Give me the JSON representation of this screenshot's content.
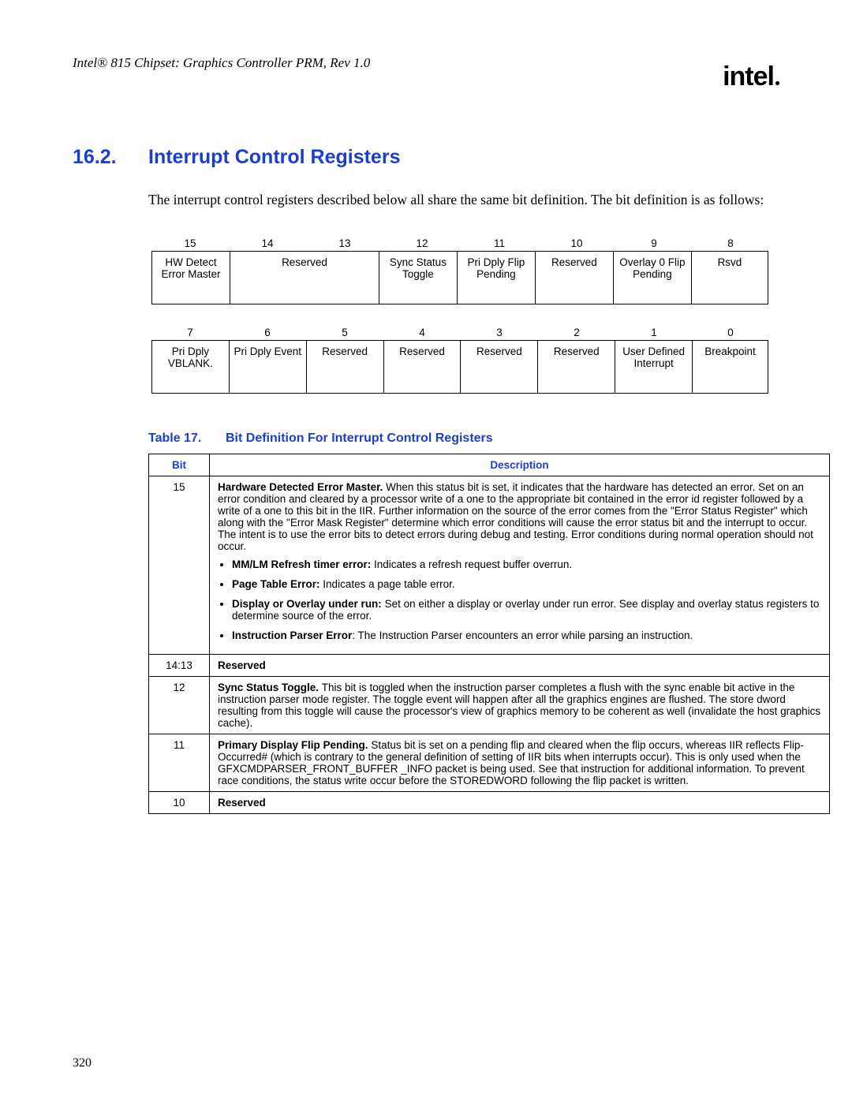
{
  "header": {
    "text": "Intel® 815 Chipset: Graphics Controller PRM, Rev 1.0"
  },
  "logo": "intel",
  "section": {
    "number": "16.2.",
    "title": "Interrupt Control Registers"
  },
  "intro": "The interrupt control registers described below all share the same bit definition. The bit definition is as follows:",
  "bits_high": {
    "headers": [
      "15",
      "14",
      "13",
      "12",
      "11",
      "10",
      "9",
      "8"
    ],
    "cells": [
      "HW Detect Error Master",
      "Reserved",
      "Sync Status Toggle",
      "Pri Dply Flip Pending",
      "Reserved",
      "Overlay 0 Flip Pending",
      "Rsvd"
    ]
  },
  "bits_low": {
    "headers": [
      "7",
      "6",
      "5",
      "4",
      "3",
      "2",
      "1",
      "0"
    ],
    "cells": [
      "Pri Dply VBLANK.",
      "Pri Dply Event",
      "Reserved",
      "Reserved",
      "Reserved",
      "Reserved",
      "User Defined Interrupt",
      "Breakpoint"
    ]
  },
  "table_caption": {
    "left": "Table 17.",
    "right": "Bit Definition For Interrupt Control Registers"
  },
  "defs": {
    "col_bit": "Bit",
    "col_desc": "Description",
    "rows": [
      {
        "bit": "15",
        "lead": "Hardware Detected Error Master. ",
        "body": "When this status bit is set, it indicates that the hardware has detected an error. Set on an error condition and cleared by a processor write of a one to the appropriate bit contained in the error id register followed by a write of a one to this bit in the IIR. Further information on the source of the error comes from the \"Error Status Register\" which along with the \"Error Mask Register\" determine which error conditions will cause the error status bit and the interrupt to occur. The intent is to use the error bits to detect errors during debug and testing. Error conditions during normal operation should not occur.",
        "bullets": [
          {
            "lead": "MM/LM Refresh timer error: ",
            "text": "Indicates a refresh request buffer overrun."
          },
          {
            "lead": "Page Table Error: ",
            "text": "Indicates a page table error."
          },
          {
            "lead": "Display or Overlay under run: ",
            "text": "Set on either a display or overlay under run error. See display and overlay status registers to determine source of the error."
          },
          {
            "lead": "Instruction Parser Error",
            "text": ": The Instruction Parser encounters an error while parsing an instruction."
          }
        ]
      },
      {
        "bit": "14:13",
        "lead": "Reserved",
        "body": ""
      },
      {
        "bit": "12",
        "lead": "Sync Status Toggle. ",
        "body": "This bit is toggled when the instruction parser completes a flush with the sync enable bit active in the instruction parser mode register. The toggle event will happen after all the graphics engines are flushed. The store dword resulting from this toggle will cause the processor's view of graphics memory to be coherent as well (invalidate the host graphics cache)."
      },
      {
        "bit": "11",
        "lead": "Primary Display Flip Pending. ",
        "body": "Status bit is set on a pending flip and cleared when the flip occurs, whereas IIR reflects Flip-Occurred# (which is contrary to the general definition of setting of IIR bits when interrupts occur). This is only used when the GFXCMDPARSER_FRONT_BUFFER _INFO packet is being used. See that instruction for additional information. To prevent race conditions, the status write occur before the STOREDWORD following the flip packet is written."
      },
      {
        "bit": "10",
        "lead": "Reserved",
        "body": ""
      }
    ]
  },
  "page_number": "320"
}
